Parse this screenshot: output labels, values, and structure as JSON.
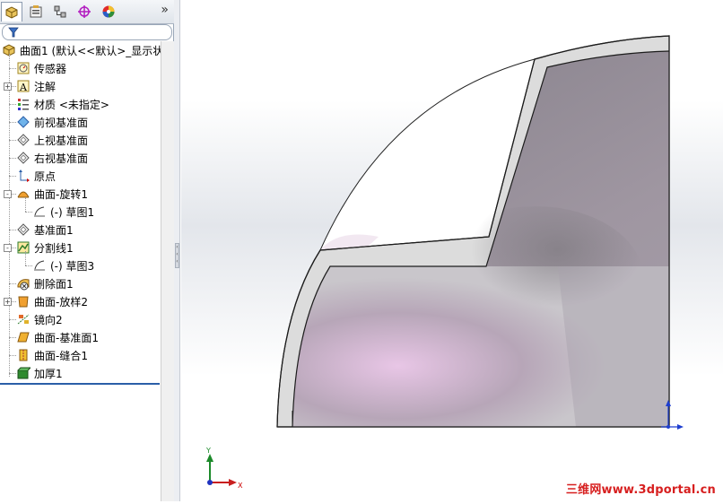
{
  "panel": {
    "tabs": [
      "feature-manager-tab",
      "property-manager-tab",
      "configuration-manager-tab",
      "dimxpert-manager-tab",
      "display-manager-tab"
    ],
    "more": "»"
  },
  "tree": {
    "root": "曲面1  (默认<<默认>_显示状",
    "items": [
      {
        "label": "传感器",
        "icon": "sensor-icon"
      },
      {
        "label": "注解",
        "icon": "annotation-icon"
      },
      {
        "label": "材质 <未指定>",
        "icon": "material-icon"
      },
      {
        "label": "前视基准面",
        "icon": "plane-icon"
      },
      {
        "label": "上视基准面",
        "icon": "plane-icon"
      },
      {
        "label": "右视基准面",
        "icon": "plane-icon"
      },
      {
        "label": "原点",
        "icon": "origin-icon"
      },
      {
        "label": "曲面-旋转1",
        "icon": "surface-revolve-icon"
      },
      {
        "label": "(-) 草图1",
        "icon": "sketch-icon"
      },
      {
        "label": "基准面1",
        "icon": "plane-icon"
      },
      {
        "label": "分割线1",
        "icon": "split-line-icon"
      },
      {
        "label": "(-) 草图3",
        "icon": "sketch-icon"
      },
      {
        "label": "删除面1",
        "icon": "delete-face-icon"
      },
      {
        "label": "曲面-放样2",
        "icon": "surface-loft-icon"
      },
      {
        "label": "镜向2",
        "icon": "mirror-icon"
      },
      {
        "label": "曲面-基准面1",
        "icon": "planar-surface-icon"
      },
      {
        "label": "曲面-缝合1",
        "icon": "knit-surface-icon"
      },
      {
        "label": "加厚1",
        "icon": "thicken-icon"
      }
    ]
  },
  "triad": {
    "y": "Y",
    "x": "X"
  },
  "watermark": "三维网www.3dportal.cn",
  "colors": {
    "selection_blue": "#2b5fa8",
    "watermark_red": "#d71f1f"
  }
}
